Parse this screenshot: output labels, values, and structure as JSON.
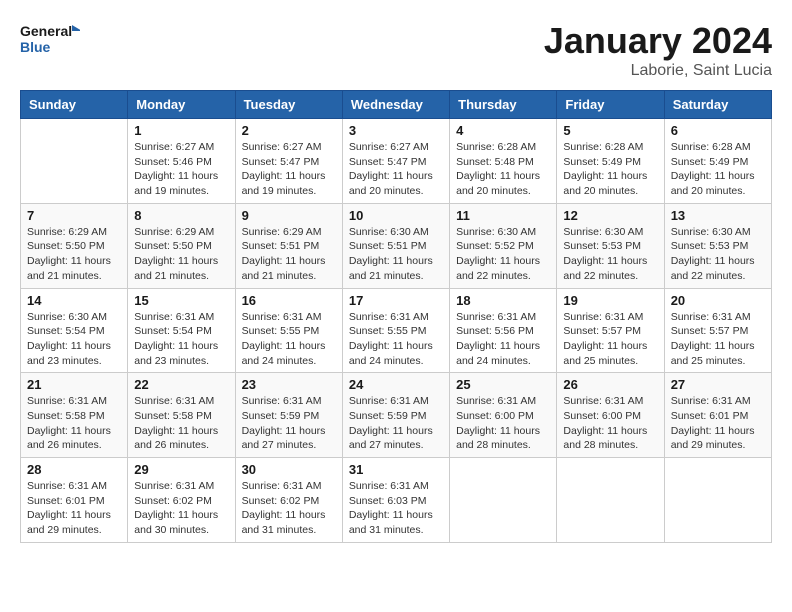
{
  "header": {
    "logo_line1": "General",
    "logo_line2": "Blue",
    "title": "January 2024",
    "subtitle": "Laborie, Saint Lucia"
  },
  "weekdays": [
    "Sunday",
    "Monday",
    "Tuesday",
    "Wednesday",
    "Thursday",
    "Friday",
    "Saturday"
  ],
  "weeks": [
    [
      {
        "day": "",
        "info": ""
      },
      {
        "day": "1",
        "info": "Sunrise: 6:27 AM\nSunset: 5:46 PM\nDaylight: 11 hours\nand 19 minutes."
      },
      {
        "day": "2",
        "info": "Sunrise: 6:27 AM\nSunset: 5:47 PM\nDaylight: 11 hours\nand 19 minutes."
      },
      {
        "day": "3",
        "info": "Sunrise: 6:27 AM\nSunset: 5:47 PM\nDaylight: 11 hours\nand 20 minutes."
      },
      {
        "day": "4",
        "info": "Sunrise: 6:28 AM\nSunset: 5:48 PM\nDaylight: 11 hours\nand 20 minutes."
      },
      {
        "day": "5",
        "info": "Sunrise: 6:28 AM\nSunset: 5:49 PM\nDaylight: 11 hours\nand 20 minutes."
      },
      {
        "day": "6",
        "info": "Sunrise: 6:28 AM\nSunset: 5:49 PM\nDaylight: 11 hours\nand 20 minutes."
      }
    ],
    [
      {
        "day": "7",
        "info": "Sunrise: 6:29 AM\nSunset: 5:50 PM\nDaylight: 11 hours\nand 21 minutes."
      },
      {
        "day": "8",
        "info": "Sunrise: 6:29 AM\nSunset: 5:50 PM\nDaylight: 11 hours\nand 21 minutes."
      },
      {
        "day": "9",
        "info": "Sunrise: 6:29 AM\nSunset: 5:51 PM\nDaylight: 11 hours\nand 21 minutes."
      },
      {
        "day": "10",
        "info": "Sunrise: 6:30 AM\nSunset: 5:51 PM\nDaylight: 11 hours\nand 21 minutes."
      },
      {
        "day": "11",
        "info": "Sunrise: 6:30 AM\nSunset: 5:52 PM\nDaylight: 11 hours\nand 22 minutes."
      },
      {
        "day": "12",
        "info": "Sunrise: 6:30 AM\nSunset: 5:53 PM\nDaylight: 11 hours\nand 22 minutes."
      },
      {
        "day": "13",
        "info": "Sunrise: 6:30 AM\nSunset: 5:53 PM\nDaylight: 11 hours\nand 22 minutes."
      }
    ],
    [
      {
        "day": "14",
        "info": "Sunrise: 6:30 AM\nSunset: 5:54 PM\nDaylight: 11 hours\nand 23 minutes."
      },
      {
        "day": "15",
        "info": "Sunrise: 6:31 AM\nSunset: 5:54 PM\nDaylight: 11 hours\nand 23 minutes."
      },
      {
        "day": "16",
        "info": "Sunrise: 6:31 AM\nSunset: 5:55 PM\nDaylight: 11 hours\nand 24 minutes."
      },
      {
        "day": "17",
        "info": "Sunrise: 6:31 AM\nSunset: 5:55 PM\nDaylight: 11 hours\nand 24 minutes."
      },
      {
        "day": "18",
        "info": "Sunrise: 6:31 AM\nSunset: 5:56 PM\nDaylight: 11 hours\nand 24 minutes."
      },
      {
        "day": "19",
        "info": "Sunrise: 6:31 AM\nSunset: 5:57 PM\nDaylight: 11 hours\nand 25 minutes."
      },
      {
        "day": "20",
        "info": "Sunrise: 6:31 AM\nSunset: 5:57 PM\nDaylight: 11 hours\nand 25 minutes."
      }
    ],
    [
      {
        "day": "21",
        "info": "Sunrise: 6:31 AM\nSunset: 5:58 PM\nDaylight: 11 hours\nand 26 minutes."
      },
      {
        "day": "22",
        "info": "Sunrise: 6:31 AM\nSunset: 5:58 PM\nDaylight: 11 hours\nand 26 minutes."
      },
      {
        "day": "23",
        "info": "Sunrise: 6:31 AM\nSunset: 5:59 PM\nDaylight: 11 hours\nand 27 minutes."
      },
      {
        "day": "24",
        "info": "Sunrise: 6:31 AM\nSunset: 5:59 PM\nDaylight: 11 hours\nand 27 minutes."
      },
      {
        "day": "25",
        "info": "Sunrise: 6:31 AM\nSunset: 6:00 PM\nDaylight: 11 hours\nand 28 minutes."
      },
      {
        "day": "26",
        "info": "Sunrise: 6:31 AM\nSunset: 6:00 PM\nDaylight: 11 hours\nand 28 minutes."
      },
      {
        "day": "27",
        "info": "Sunrise: 6:31 AM\nSunset: 6:01 PM\nDaylight: 11 hours\nand 29 minutes."
      }
    ],
    [
      {
        "day": "28",
        "info": "Sunrise: 6:31 AM\nSunset: 6:01 PM\nDaylight: 11 hours\nand 29 minutes."
      },
      {
        "day": "29",
        "info": "Sunrise: 6:31 AM\nSunset: 6:02 PM\nDaylight: 11 hours\nand 30 minutes."
      },
      {
        "day": "30",
        "info": "Sunrise: 6:31 AM\nSunset: 6:02 PM\nDaylight: 11 hours\nand 31 minutes."
      },
      {
        "day": "31",
        "info": "Sunrise: 6:31 AM\nSunset: 6:03 PM\nDaylight: 11 hours\nand 31 minutes."
      },
      {
        "day": "",
        "info": ""
      },
      {
        "day": "",
        "info": ""
      },
      {
        "day": "",
        "info": ""
      }
    ]
  ]
}
